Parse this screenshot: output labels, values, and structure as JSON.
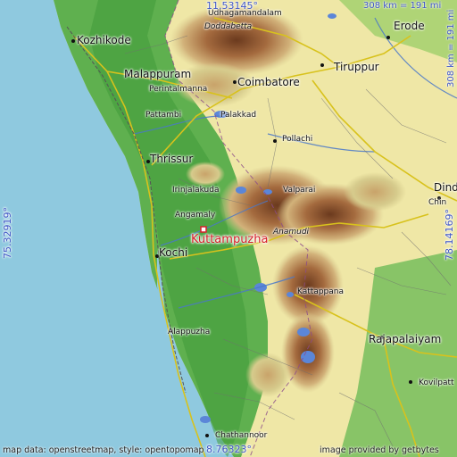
{
  "coordinates": {
    "top": "11.53145°",
    "bottom": "8.76323°",
    "left": "75.32919°",
    "right": "78.14169°"
  },
  "scale": {
    "horizontal": "308 km = 191 mi",
    "vertical": "308 km = 191 mi"
  },
  "focus_place": "Kuttampuzha",
  "places": {
    "kozhikode": "Kozhikode",
    "udhagamandalam": "Udhagamandalam",
    "doddabetta": "Doddabetta",
    "erode": "Erode",
    "malappuram": "Malappuram",
    "tiruppur": "Tiruppur",
    "perintalmanna": "Perintalmanna",
    "coimbatore": "Coimbatore",
    "pattambi": "Pattambi",
    "palakkad": "Palakkad",
    "pollachi": "Pollachi",
    "thrissur": "Thrissur",
    "valparai": "Valparai",
    "dindigul": "Dind",
    "irinjalakuda": "Irinjalakuda",
    "chinnalapatti": "Chin",
    "angamaly": "Angamaly",
    "anamudi": "Anamudi",
    "kochi": "Kochi",
    "kattappana": "Kattappana",
    "alappuzha": "Alappuzha",
    "rajapalaiyam": "Rajapalaiyam",
    "kovilpatti": "Kovilpatt",
    "chathannoor": "Chathannoor"
  },
  "credits": {
    "left": "map data: openstreetmap, style: opentopomap",
    "right": "image provided by getbytes"
  }
}
